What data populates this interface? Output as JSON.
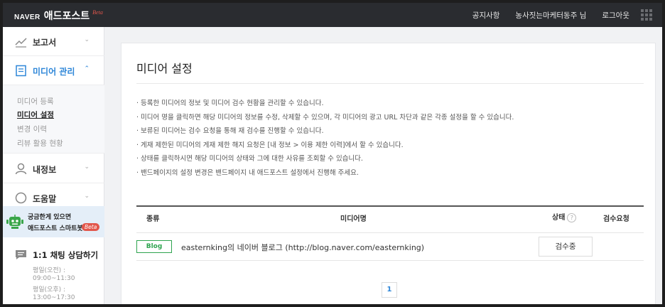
{
  "header": {
    "naver": "NAVER",
    "brand": "애드포스트",
    "beta": "Beta",
    "nav": [
      "공지사항",
      "농사짓는마케터동주 님",
      "로그아웃"
    ]
  },
  "sidebar": {
    "report": "보고서",
    "media": "미디어 관리",
    "submenu": [
      "미디어 등록",
      "미디어 설정",
      "변경 이력",
      "리뷰 활용 현황"
    ],
    "myinfo": "내정보",
    "help": "도움말",
    "bot_line1": "궁금한게 있으면",
    "bot_line2": "애드포스트 스마트봇",
    "bot_badge": "Beta",
    "chat_title": "1:1 채팅 상담하기",
    "hours": [
      "평일(오전) :",
      "09:00~11:30",
      "평일(오후) :",
      "13:00~17:30"
    ]
  },
  "main": {
    "title": "미디어 설정",
    "notes": [
      "· 등록한 미디어의 정보 및 미디어 검수 현황을 관리할 수 있습니다.",
      "· 미디어 명을 클릭하면 해당 미디어의 정보를 수정, 삭제할 수 있으며, 각 미디어의 광고 URL 차단과 같은 각종 설정을 할 수 있습니다.",
      "· 보류된 미디어는 검수 요청을 통해 재 검수를 진행할 수 있습니다.",
      "· 게재 제한된 미디어의 게재 제한 해지 요청은 [내 정보 > 이용 제한 이력]에서 할 수 있습니다.",
      "· 상태를 클릭하시면 해당 미디어의 상태와 그에 대한 사유를 조회할 수 있습니다.",
      "· 밴드페이지의 설정 변경은 밴드페이지 내 애드포스트 설정에서 진행해 주세요."
    ],
    "table": {
      "headers": [
        "종류",
        "미디어명",
        "상태",
        "검수요청"
      ],
      "help_mark": "?",
      "rows": [
        {
          "type": "Blog",
          "name": "easternking의 네이버 블로그 (http://blog.naver.com/easternking)",
          "status": "검수중"
        }
      ]
    },
    "page": "1"
  },
  "colors": {
    "accent": "#2d86d8",
    "topbar": "#2a2c30",
    "blog_tag": "#2ea44f",
    "beta": "#e2574c"
  }
}
